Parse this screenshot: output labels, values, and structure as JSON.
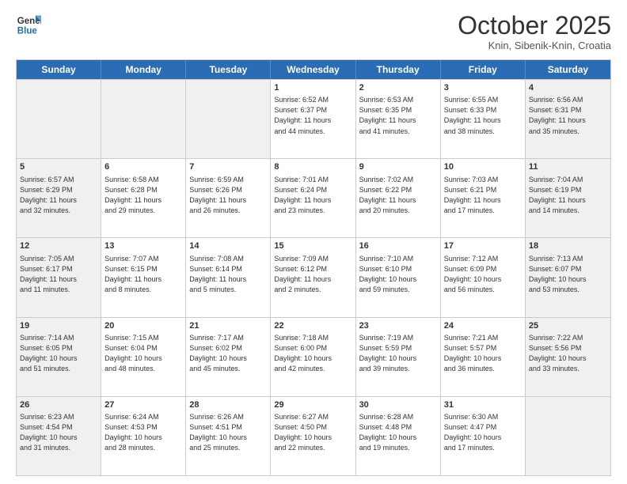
{
  "header": {
    "logo_line1": "General",
    "logo_line2": "Blue",
    "month": "October 2025",
    "location": "Knin, Sibenik-Knin, Croatia"
  },
  "days_of_week": [
    "Sunday",
    "Monday",
    "Tuesday",
    "Wednesday",
    "Thursday",
    "Friday",
    "Saturday"
  ],
  "weeks": [
    [
      {
        "day": "",
        "info": "",
        "shaded": true
      },
      {
        "day": "",
        "info": "",
        "shaded": true
      },
      {
        "day": "",
        "info": "",
        "shaded": true
      },
      {
        "day": "1",
        "info": "Sunrise: 6:52 AM\nSunset: 6:37 PM\nDaylight: 11 hours\nand 44 minutes.",
        "shaded": false
      },
      {
        "day": "2",
        "info": "Sunrise: 6:53 AM\nSunset: 6:35 PM\nDaylight: 11 hours\nand 41 minutes.",
        "shaded": false
      },
      {
        "day": "3",
        "info": "Sunrise: 6:55 AM\nSunset: 6:33 PM\nDaylight: 11 hours\nand 38 minutes.",
        "shaded": false
      },
      {
        "day": "4",
        "info": "Sunrise: 6:56 AM\nSunset: 6:31 PM\nDaylight: 11 hours\nand 35 minutes.",
        "shaded": true
      }
    ],
    [
      {
        "day": "5",
        "info": "Sunrise: 6:57 AM\nSunset: 6:29 PM\nDaylight: 11 hours\nand 32 minutes.",
        "shaded": true
      },
      {
        "day": "6",
        "info": "Sunrise: 6:58 AM\nSunset: 6:28 PM\nDaylight: 11 hours\nand 29 minutes.",
        "shaded": false
      },
      {
        "day": "7",
        "info": "Sunrise: 6:59 AM\nSunset: 6:26 PM\nDaylight: 11 hours\nand 26 minutes.",
        "shaded": false
      },
      {
        "day": "8",
        "info": "Sunrise: 7:01 AM\nSunset: 6:24 PM\nDaylight: 11 hours\nand 23 minutes.",
        "shaded": false
      },
      {
        "day": "9",
        "info": "Sunrise: 7:02 AM\nSunset: 6:22 PM\nDaylight: 11 hours\nand 20 minutes.",
        "shaded": false
      },
      {
        "day": "10",
        "info": "Sunrise: 7:03 AM\nSunset: 6:21 PM\nDaylight: 11 hours\nand 17 minutes.",
        "shaded": false
      },
      {
        "day": "11",
        "info": "Sunrise: 7:04 AM\nSunset: 6:19 PM\nDaylight: 11 hours\nand 14 minutes.",
        "shaded": true
      }
    ],
    [
      {
        "day": "12",
        "info": "Sunrise: 7:05 AM\nSunset: 6:17 PM\nDaylight: 11 hours\nand 11 minutes.",
        "shaded": true
      },
      {
        "day": "13",
        "info": "Sunrise: 7:07 AM\nSunset: 6:15 PM\nDaylight: 11 hours\nand 8 minutes.",
        "shaded": false
      },
      {
        "day": "14",
        "info": "Sunrise: 7:08 AM\nSunset: 6:14 PM\nDaylight: 11 hours\nand 5 minutes.",
        "shaded": false
      },
      {
        "day": "15",
        "info": "Sunrise: 7:09 AM\nSunset: 6:12 PM\nDaylight: 11 hours\nand 2 minutes.",
        "shaded": false
      },
      {
        "day": "16",
        "info": "Sunrise: 7:10 AM\nSunset: 6:10 PM\nDaylight: 10 hours\nand 59 minutes.",
        "shaded": false
      },
      {
        "day": "17",
        "info": "Sunrise: 7:12 AM\nSunset: 6:09 PM\nDaylight: 10 hours\nand 56 minutes.",
        "shaded": false
      },
      {
        "day": "18",
        "info": "Sunrise: 7:13 AM\nSunset: 6:07 PM\nDaylight: 10 hours\nand 53 minutes.",
        "shaded": true
      }
    ],
    [
      {
        "day": "19",
        "info": "Sunrise: 7:14 AM\nSunset: 6:05 PM\nDaylight: 10 hours\nand 51 minutes.",
        "shaded": true
      },
      {
        "day": "20",
        "info": "Sunrise: 7:15 AM\nSunset: 6:04 PM\nDaylight: 10 hours\nand 48 minutes.",
        "shaded": false
      },
      {
        "day": "21",
        "info": "Sunrise: 7:17 AM\nSunset: 6:02 PM\nDaylight: 10 hours\nand 45 minutes.",
        "shaded": false
      },
      {
        "day": "22",
        "info": "Sunrise: 7:18 AM\nSunset: 6:00 PM\nDaylight: 10 hours\nand 42 minutes.",
        "shaded": false
      },
      {
        "day": "23",
        "info": "Sunrise: 7:19 AM\nSunset: 5:59 PM\nDaylight: 10 hours\nand 39 minutes.",
        "shaded": false
      },
      {
        "day": "24",
        "info": "Sunrise: 7:21 AM\nSunset: 5:57 PM\nDaylight: 10 hours\nand 36 minutes.",
        "shaded": false
      },
      {
        "day": "25",
        "info": "Sunrise: 7:22 AM\nSunset: 5:56 PM\nDaylight: 10 hours\nand 33 minutes.",
        "shaded": true
      }
    ],
    [
      {
        "day": "26",
        "info": "Sunrise: 6:23 AM\nSunset: 4:54 PM\nDaylight: 10 hours\nand 31 minutes.",
        "shaded": true
      },
      {
        "day": "27",
        "info": "Sunrise: 6:24 AM\nSunset: 4:53 PM\nDaylight: 10 hours\nand 28 minutes.",
        "shaded": false
      },
      {
        "day": "28",
        "info": "Sunrise: 6:26 AM\nSunset: 4:51 PM\nDaylight: 10 hours\nand 25 minutes.",
        "shaded": false
      },
      {
        "day": "29",
        "info": "Sunrise: 6:27 AM\nSunset: 4:50 PM\nDaylight: 10 hours\nand 22 minutes.",
        "shaded": false
      },
      {
        "day": "30",
        "info": "Sunrise: 6:28 AM\nSunset: 4:48 PM\nDaylight: 10 hours\nand 19 minutes.",
        "shaded": false
      },
      {
        "day": "31",
        "info": "Sunrise: 6:30 AM\nSunset: 4:47 PM\nDaylight: 10 hours\nand 17 minutes.",
        "shaded": false
      },
      {
        "day": "",
        "info": "",
        "shaded": true
      }
    ]
  ]
}
